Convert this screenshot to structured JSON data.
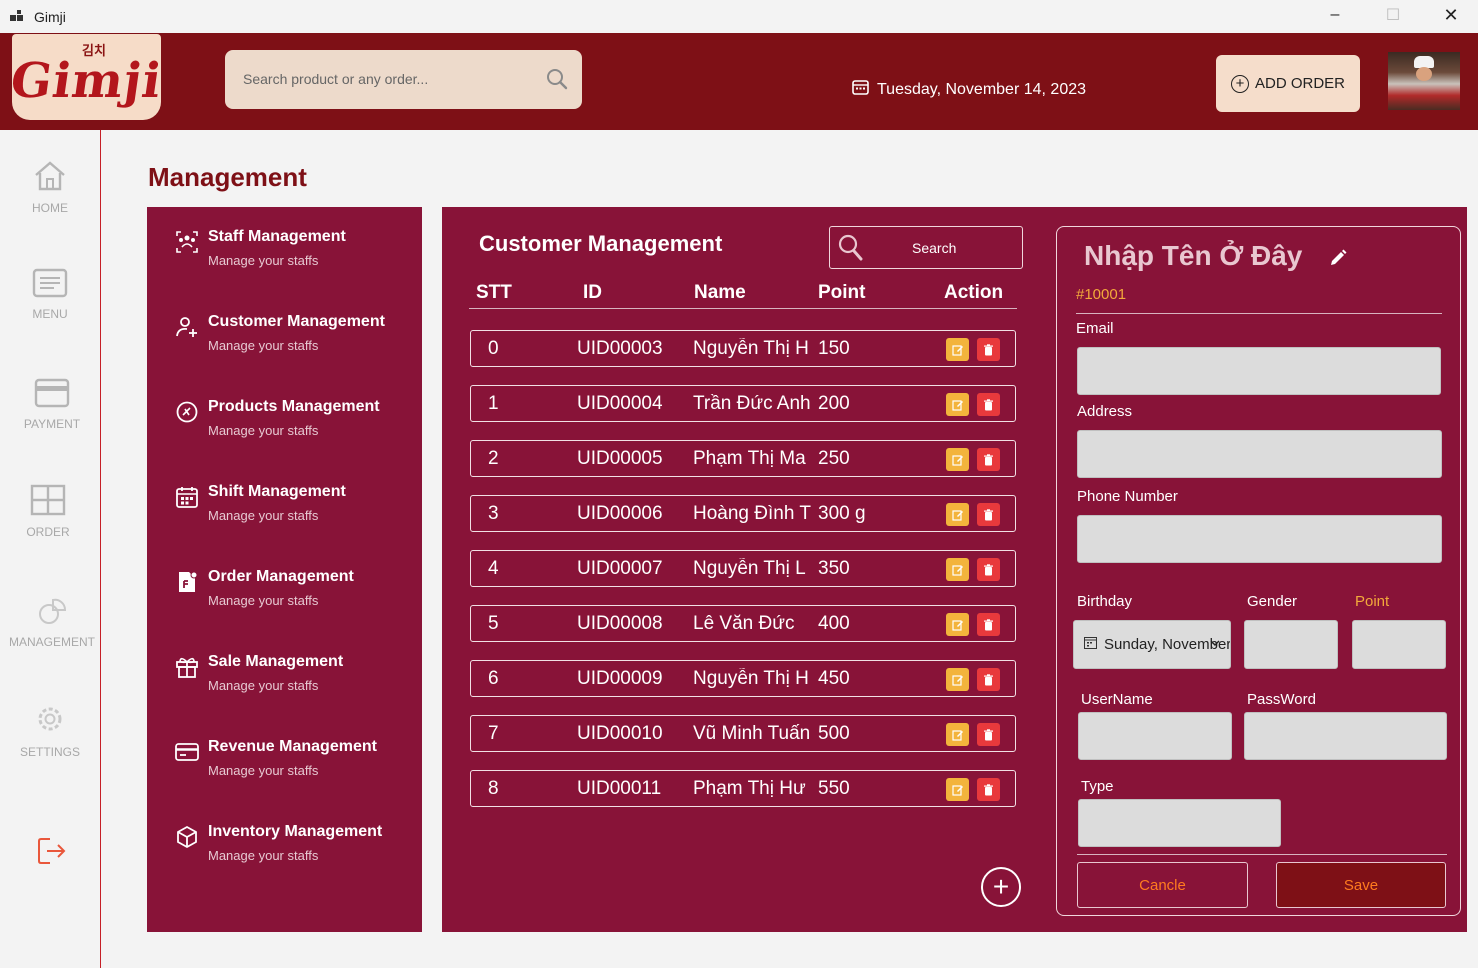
{
  "window": {
    "title": "Gimji",
    "minimize": "–",
    "maximize": "☐",
    "close": "✕"
  },
  "header": {
    "logo_text": "Gimji",
    "logo_korean": "김치",
    "search_placeholder": "Search product or any order...",
    "date": "Tuesday, November 14, 2023",
    "add_order_label": "ADD ORDER"
  },
  "sidebar": {
    "items": [
      {
        "label": "HOME",
        "icon": "home-icon"
      },
      {
        "label": "MENU",
        "icon": "menu-icon"
      },
      {
        "label": "PAYMENT",
        "icon": "payment-icon"
      },
      {
        "label": "ORDER",
        "icon": "order-icon"
      },
      {
        "label": "MANAGEMENT",
        "icon": "management-icon"
      },
      {
        "label": "SETTINGS",
        "icon": "settings-icon"
      }
    ],
    "logout_icon": "logout-icon"
  },
  "page": {
    "title": "Management"
  },
  "management_menu": [
    {
      "title": "Staff Management",
      "subtitle": "Manage your staffs",
      "icon": "staff-icon"
    },
    {
      "title": "Customer Management",
      "subtitle": "Manage your staffs",
      "icon": "customer-add-icon"
    },
    {
      "title": "Products Management",
      "subtitle": "Manage your staffs",
      "icon": "product-icon"
    },
    {
      "title": "Shift Management",
      "subtitle": "Manage your staffs",
      "icon": "calendar-icon"
    },
    {
      "title": "Order Management",
      "subtitle": "Manage your staffs",
      "icon": "order-doc-icon"
    },
    {
      "title": "Sale Management",
      "subtitle": "Manage your staffs",
      "icon": "gift-icon"
    },
    {
      "title": "Revenue Management",
      "subtitle": "Manage your staffs",
      "icon": "card-icon"
    },
    {
      "title": "Inventory Management",
      "subtitle": "Manage your staffs",
      "icon": "box-icon"
    }
  ],
  "customer_panel": {
    "title": "Customer Management",
    "search_label": "Search",
    "columns": [
      "STT",
      "ID",
      "Name",
      "Point",
      "Action"
    ],
    "rows": [
      {
        "stt": "0",
        "id": "UID00003",
        "name": "Nguyễn Thị H",
        "point": "150"
      },
      {
        "stt": "1",
        "id": "UID00004",
        "name": "Trần Đức Anh",
        "point": "200"
      },
      {
        "stt": "2",
        "id": "UID00005",
        "name": "Phạm Thị Ma",
        "point": "250"
      },
      {
        "stt": "3",
        "id": "UID00006",
        "name": "Hoàng Đình T",
        "point": "300 g"
      },
      {
        "stt": "4",
        "id": "UID00007",
        "name": "Nguyễn Thị L",
        "point": "350"
      },
      {
        "stt": "5",
        "id": "UID00008",
        "name": "Lê Văn Đức",
        "point": "400"
      },
      {
        "stt": "6",
        "id": "UID00009",
        "name": "Nguyễn Thị H",
        "point": "450"
      },
      {
        "stt": "7",
        "id": "UID00010",
        "name": "Vũ Minh Tuấn",
        "point": "500"
      },
      {
        "stt": "8",
        "id": "UID00011",
        "name": "Phạm Thị Hư",
        "point": "550"
      }
    ]
  },
  "form": {
    "name": "Nhập Tên Ở Đây",
    "id": "#10001",
    "email_label": "Email",
    "address_label": "Address",
    "phone_label": "Phone Number",
    "birthday_label": "Birthday",
    "birthday_value": "Sunday, November",
    "gender_label": "Gender",
    "point_label": "Point",
    "username_label": "UserName",
    "password_label": "PassWord",
    "type_label": "Type",
    "cancel_label": "Cancle",
    "save_label": "Save"
  },
  "colors": {
    "brand": "#7e1016",
    "panel": "#881338",
    "accent": "#f2a93b",
    "edit": "#f3b43c",
    "delete": "#e8393c"
  }
}
